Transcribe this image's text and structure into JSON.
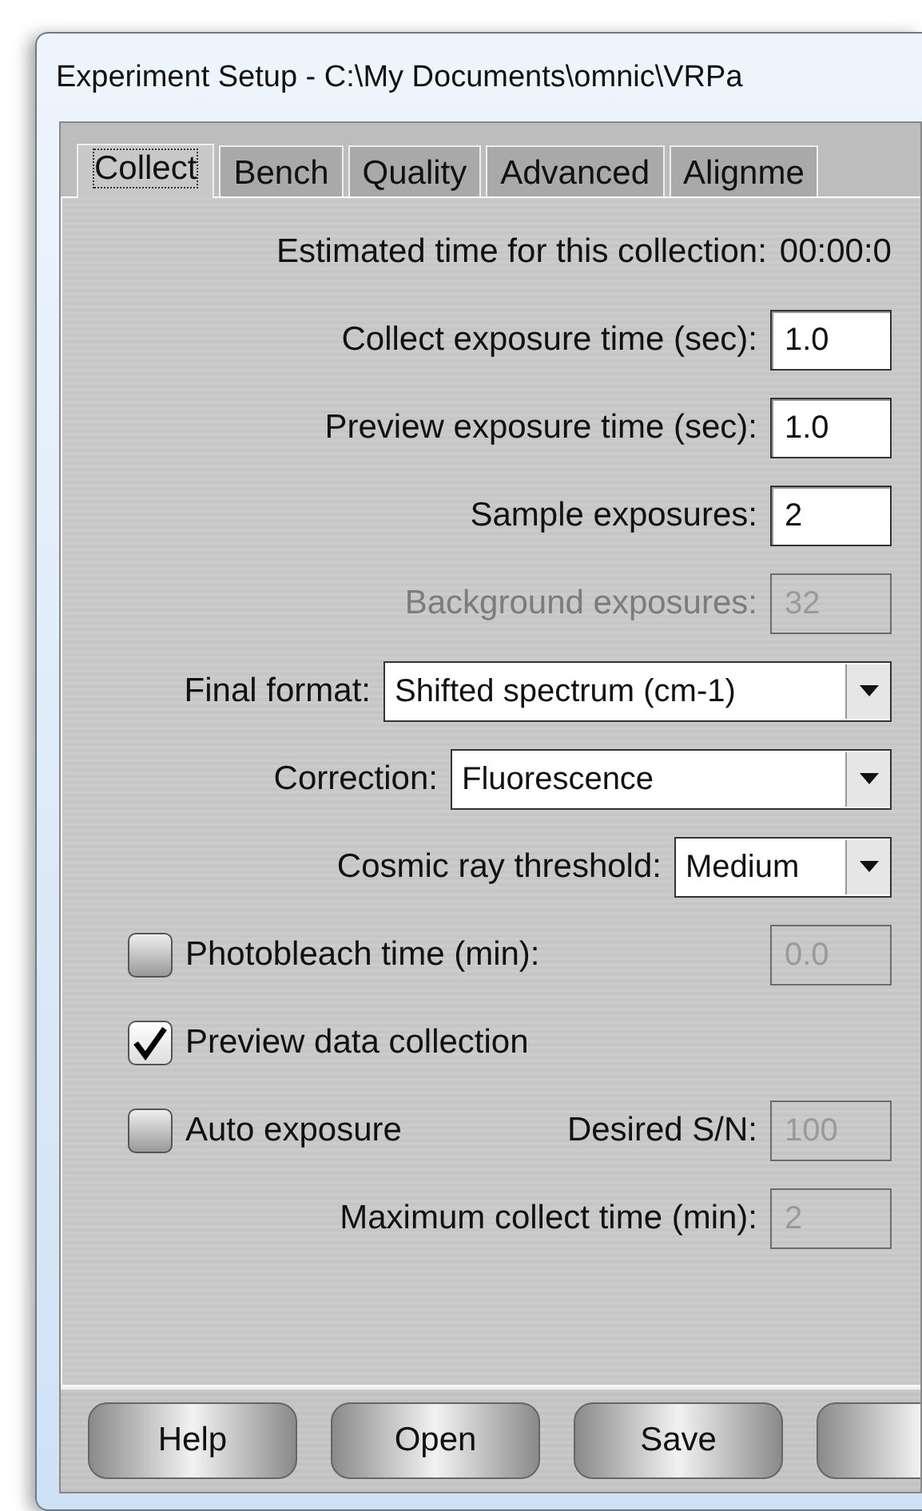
{
  "window": {
    "title": "Experiment Setup - C:\\My Documents\\omnic\\VRPa"
  },
  "tabs": [
    {
      "label": "Collect",
      "selected": true
    },
    {
      "label": "Bench",
      "selected": false
    },
    {
      "label": "Quality",
      "selected": false
    },
    {
      "label": "Advanced",
      "selected": false
    },
    {
      "label": "Alignme",
      "selected": false
    }
  ],
  "rows": [
    {
      "kind": "readout",
      "label": "Estimated time for this collection:",
      "value": "00:00:0"
    },
    {
      "kind": "field",
      "label": "Collect exposure time (sec):",
      "value": "1.0",
      "disabled": false
    },
    {
      "kind": "field",
      "label": "Preview exposure time (sec):",
      "value": "1.0",
      "disabled": false
    },
    {
      "kind": "field",
      "label": "Sample exposures:",
      "value": "2",
      "disabled": false
    },
    {
      "kind": "field",
      "label": "Background exposures:",
      "value": "32",
      "disabled": true,
      "label_disabled": true
    },
    {
      "kind": "select",
      "label": "Final format:",
      "value": "Shifted spectrum (cm-1)"
    },
    {
      "kind": "select",
      "label": "Correction:",
      "value": "Fluorescence"
    },
    {
      "kind": "select",
      "label": "Cosmic ray threshold:",
      "value": "Medium"
    },
    {
      "kind": "checkbox",
      "label": "Photobleach time (min):",
      "checked": false,
      "field": {
        "value": "0.0",
        "disabled": true
      }
    },
    {
      "kind": "checkbox",
      "label": "Preview data collection",
      "checked": true
    },
    {
      "kind": "checkbox",
      "label": "Auto exposure",
      "checked": false,
      "field": {
        "label": "Desired S/N:",
        "value": "100",
        "disabled": true
      }
    },
    {
      "kind": "field",
      "label": "Maximum collect time (min):",
      "value": "2",
      "disabled": true
    }
  ],
  "buttons": [
    {
      "kind": "labeled",
      "label": "Help"
    },
    {
      "kind": "labeled",
      "label": "Open"
    },
    {
      "kind": "labeled",
      "label": "Save"
    },
    {
      "kind": "cut-off"
    }
  ]
}
